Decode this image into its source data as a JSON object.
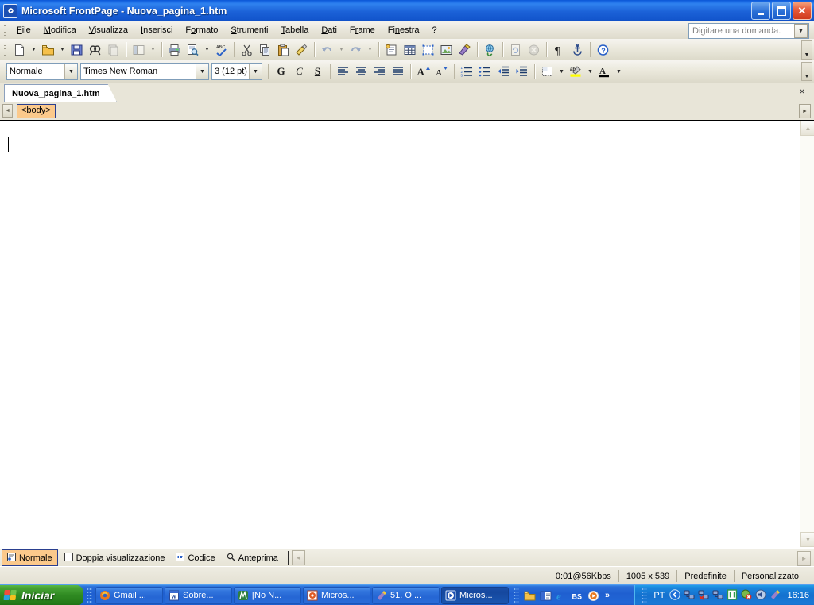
{
  "window": {
    "title": "Microsoft FrontPage - Nuova_pagina_1.htm",
    "app_icon": "frontpage-icon",
    "buttons": {
      "minimize": "minimize-button",
      "maximize": "restore-button",
      "close": "close-button"
    }
  },
  "menubar": {
    "items": [
      {
        "label": "File"
      },
      {
        "label": "Modifica"
      },
      {
        "label": "Visualizza"
      },
      {
        "label": "Inserisci"
      },
      {
        "label": "Formato"
      },
      {
        "label": "Strumenti"
      },
      {
        "label": "Tabella"
      },
      {
        "label": "Dati"
      },
      {
        "label": "Frame"
      },
      {
        "label": "Finestra"
      },
      {
        "label": "?"
      }
    ],
    "ask_box": {
      "placeholder": "Digitare una domanda."
    }
  },
  "toolbar_standard": {
    "tools": [
      {
        "name": "new-page-icon",
        "label": "Nuovo"
      },
      {
        "name": "open-icon",
        "label": "Apri"
      },
      {
        "name": "save-icon",
        "label": "Salva"
      },
      {
        "name": "search-icon",
        "label": "Cerca"
      },
      {
        "name": "publish-site-icon",
        "label": "Pubblica sito Web"
      },
      {
        "name": "toggle-pane-icon",
        "label": "Riquadro attività"
      },
      {
        "name": "print-icon",
        "label": "Stampa"
      },
      {
        "name": "print-preview-icon",
        "label": "Anteprima di stampa"
      },
      {
        "name": "spelling-icon",
        "label": "Controllo ortografia"
      },
      {
        "name": "cut-icon",
        "label": "Taglia"
      },
      {
        "name": "copy-icon",
        "label": "Copia"
      },
      {
        "name": "paste-icon",
        "label": "Incolla"
      },
      {
        "name": "format-painter-icon",
        "label": "Copia formato"
      },
      {
        "name": "undo-icon",
        "label": "Annulla"
      },
      {
        "name": "redo-icon",
        "label": "Ripristina"
      },
      {
        "name": "web-component-icon",
        "label": "Componente Web"
      },
      {
        "name": "insert-table-icon",
        "label": "Inserisci tabella"
      },
      {
        "name": "layout-table-icon",
        "label": "Tabella layout"
      },
      {
        "name": "insert-picture-icon",
        "label": "Immagine"
      },
      {
        "name": "drawing-icon",
        "label": "Disegno"
      },
      {
        "name": "hyperlink-icon",
        "label": "Collegamento ipertestuale"
      },
      {
        "name": "refresh-icon",
        "label": "Aggiorna"
      },
      {
        "name": "stop-icon",
        "label": "Interrompi"
      },
      {
        "name": "show-marks-icon",
        "label": "Mostra tutto"
      },
      {
        "name": "bookmark-icon",
        "label": "Segnalibro"
      },
      {
        "name": "help-icon",
        "label": "Guida di Microsoft FrontPage"
      }
    ],
    "overflow_label": "Altri pulsanti"
  },
  "toolbar_formatting": {
    "style": {
      "value": "Normale"
    },
    "font": {
      "value": "Times New Roman"
    },
    "size": {
      "value": "3  (12 pt)"
    },
    "bold_label": "G",
    "italic_label": "C",
    "underline_label": "S",
    "tools": [
      {
        "name": "align-left-icon",
        "label": "Allinea a sinistra"
      },
      {
        "name": "align-center-icon",
        "label": "Centra"
      },
      {
        "name": "align-right-icon",
        "label": "Allinea a destra"
      },
      {
        "name": "justify-icon",
        "label": "Giustifica"
      },
      {
        "name": "increase-font-size-icon",
        "label": "Aumenta dimensione carattere"
      },
      {
        "name": "decrease-font-size-icon",
        "label": "Riduci dimensione carattere"
      },
      {
        "name": "numbered-list-icon",
        "label": "Elenco numerato"
      },
      {
        "name": "bulleted-list-icon",
        "label": "Elenco puntato"
      },
      {
        "name": "decrease-indent-icon",
        "label": "Riduci rientro"
      },
      {
        "name": "increase-indent-icon",
        "label": "Aumenta rientro"
      },
      {
        "name": "borders-icon",
        "label": "Bordi"
      },
      {
        "name": "highlight-color-icon",
        "label": "Colore evidenziatore"
      },
      {
        "name": "font-color-icon",
        "label": "Colore carattere"
      }
    ],
    "overflow_label": "Altri pulsanti"
  },
  "document_tab": {
    "label": "Nuova_pagina_1.htm",
    "close_label": "×"
  },
  "tag_selector": {
    "scroll_left_label": "◄",
    "scroll_right_label": "►",
    "tags": [
      {
        "label": "<body>"
      }
    ]
  },
  "canvas": {
    "content": "",
    "scroll_up_label": "▲",
    "scroll_down_label": "▼"
  },
  "view_tabs": {
    "tabs": [
      {
        "label": "Normale",
        "icon": "normal-view-icon",
        "active": true
      },
      {
        "label": "Doppia visualizzazione",
        "icon": "split-view-icon",
        "active": false
      },
      {
        "label": "Codice",
        "icon": "code-view-icon",
        "active": false
      },
      {
        "label": "Anteprima",
        "icon": "preview-view-icon",
        "active": false
      }
    ],
    "scroll_left_label": "◄",
    "scroll_right_label": "►"
  },
  "statusbar": {
    "cells": [
      {
        "label": "0:01@56Kbps"
      },
      {
        "label": "1005 x 539"
      },
      {
        "label": "Predefinite"
      },
      {
        "label": "Personalizzato"
      }
    ]
  },
  "taskbar": {
    "start_label": "Iniciar",
    "buttons": [
      {
        "label": "Gmail ...",
        "icon": "firefox-icon",
        "active": false
      },
      {
        "label": "Sobre...",
        "icon": "word-icon",
        "active": false
      },
      {
        "label": "[No N...",
        "icon": "nvu-icon",
        "active": false
      },
      {
        "label": "Micros...",
        "icon": "access-icon",
        "active": false
      },
      {
        "label": "51. O ...",
        "icon": "paint-icon",
        "active": false
      },
      {
        "label": "Micros...",
        "icon": "frontpage-icon",
        "active": true
      }
    ],
    "quicklaunch": [
      {
        "name": "folder-icon"
      },
      {
        "name": "outlook-icon"
      },
      {
        "name": "internet-explorer-icon"
      },
      {
        "name": "bs-player-icon"
      },
      {
        "name": "media-player-icon"
      }
    ],
    "quicklaunch_more": "»",
    "tray": {
      "language": "PT",
      "icons": [
        {
          "name": "show-hidden-icons-icon"
        },
        {
          "name": "network-icon"
        },
        {
          "name": "network-disconnected-icon"
        },
        {
          "name": "network-2-icon"
        },
        {
          "name": "clipboard-icon"
        },
        {
          "name": "antivirus-alert-icon"
        },
        {
          "name": "volume-icon"
        },
        {
          "name": "paint-tray-icon"
        }
      ],
      "clock": "16:16"
    }
  },
  "colors": {
    "titlebar_blue": "#1d6fe8",
    "toolbar_beige": "#ece9dc",
    "tag_orange": "#fbc98b",
    "selection_blue": "#2a3f8f",
    "taskbar_blue": "#2167d6",
    "start_green": "#2f8a22"
  }
}
